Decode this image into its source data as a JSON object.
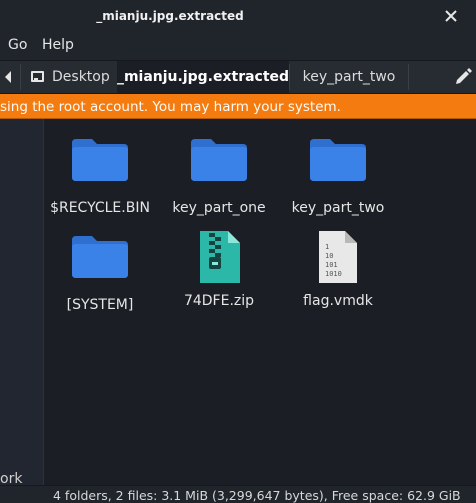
{
  "window": {
    "title": "_mianju.jpg.extracted"
  },
  "menu": {
    "items": [
      "Go",
      "Help"
    ]
  },
  "tabs": {
    "items": [
      "Desktop",
      "_mianju.jpg.extracted",
      "key_part_two"
    ],
    "active_index": 1
  },
  "warning": {
    "text": "sing the root account. You may harm your system."
  },
  "sidebar": {
    "partial_label": "ork"
  },
  "files": [
    {
      "name": "$RECYCLE.BIN",
      "type": "folder"
    },
    {
      "name": "key_part_one",
      "type": "folder"
    },
    {
      "name": "key_part_two",
      "type": "folder"
    },
    {
      "name": "[SYSTEM]",
      "type": "folder"
    },
    {
      "name": "74DFE.zip",
      "type": "archive"
    },
    {
      "name": "flag.vmdk",
      "type": "binary"
    }
  ],
  "binary_icon_digits": [
    "1",
    "10",
    "101",
    "1010"
  ],
  "status": {
    "text": "4 folders, 2 files: 3.1 MiB (3,299,647 bytes), Free space: 62.9 GiB"
  },
  "colors": {
    "folder": "#3b82e8",
    "warning": "#f47b0f",
    "archive": "#2bb8a8"
  }
}
